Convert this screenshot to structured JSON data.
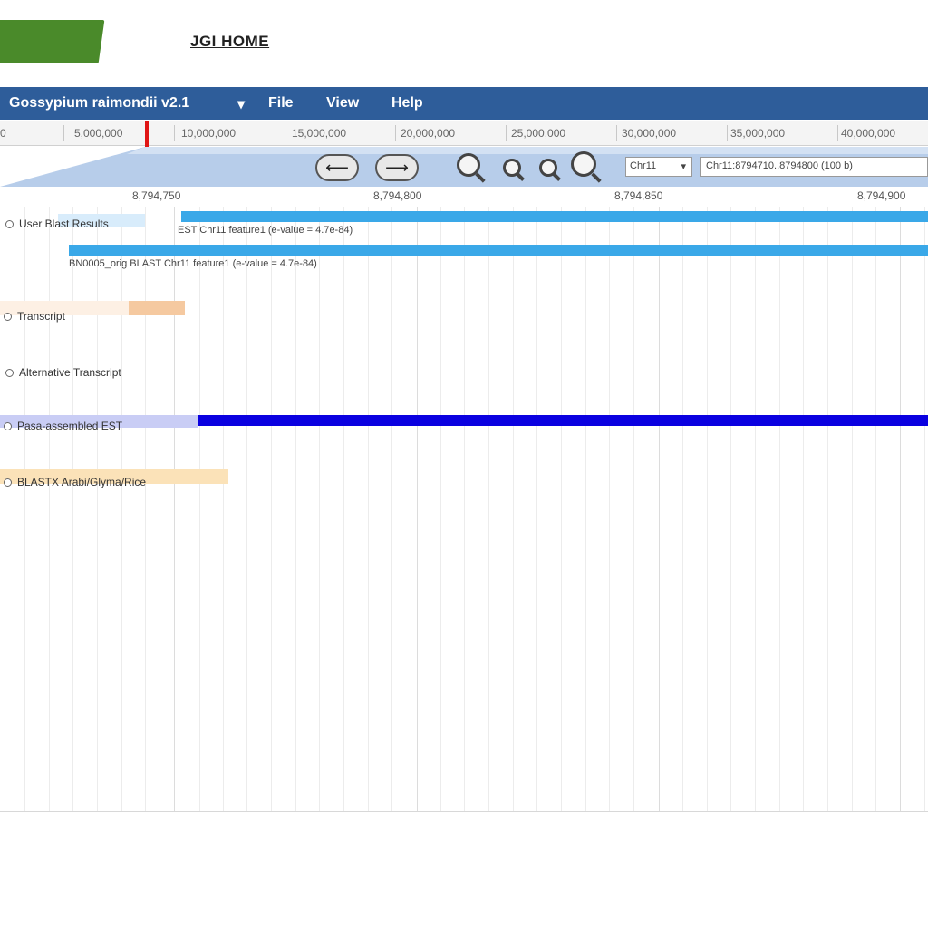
{
  "header": {
    "home_link": "JGI HOME"
  },
  "menubar": {
    "title": "Gossypium raimondii v2.1",
    "dropdown": "▾",
    "items": [
      "File",
      "View",
      "Help"
    ]
  },
  "overview": {
    "ticks": [
      "0",
      "5,000,000",
      "10,000,000",
      "15,000,000",
      "20,000,000",
      "25,000,000",
      "30,000,000",
      "35,000,000",
      "40,000,000"
    ]
  },
  "navigation": {
    "back_label": "⟵",
    "forward_label": "⟶",
    "chromosome_select": "Chr11",
    "location_value": "Chr11:8794710..8794800 (100 b)"
  },
  "detail_ruler": {
    "ticks": [
      "8,794,750",
      "8,794,800",
      "8,794,850",
      "8,794,900"
    ]
  },
  "tracks": [
    {
      "label": "User Blast Results",
      "features": [
        "EST Chr11 feature1 (e-value = 4.7e-84)",
        "BN0005_orig BLAST Chr11 feature1 (e-value = 4.7e-84)"
      ]
    },
    {
      "label": "Transcript"
    },
    {
      "label": "Alternative Transcript"
    },
    {
      "label": "Pasa-assembled EST"
    },
    {
      "label": "BLASTX Arabi/Glyma/Rice"
    }
  ],
  "colors": {
    "menubar": "#2e5d9a",
    "logo": "#4a8a2a",
    "blast_feature": "#3aa8e8",
    "transcript_feature": "#f5c9a0",
    "pasa_feature": "#0a00e0",
    "blastx_feature": "#fbe2b8",
    "marker": "#e01515"
  }
}
